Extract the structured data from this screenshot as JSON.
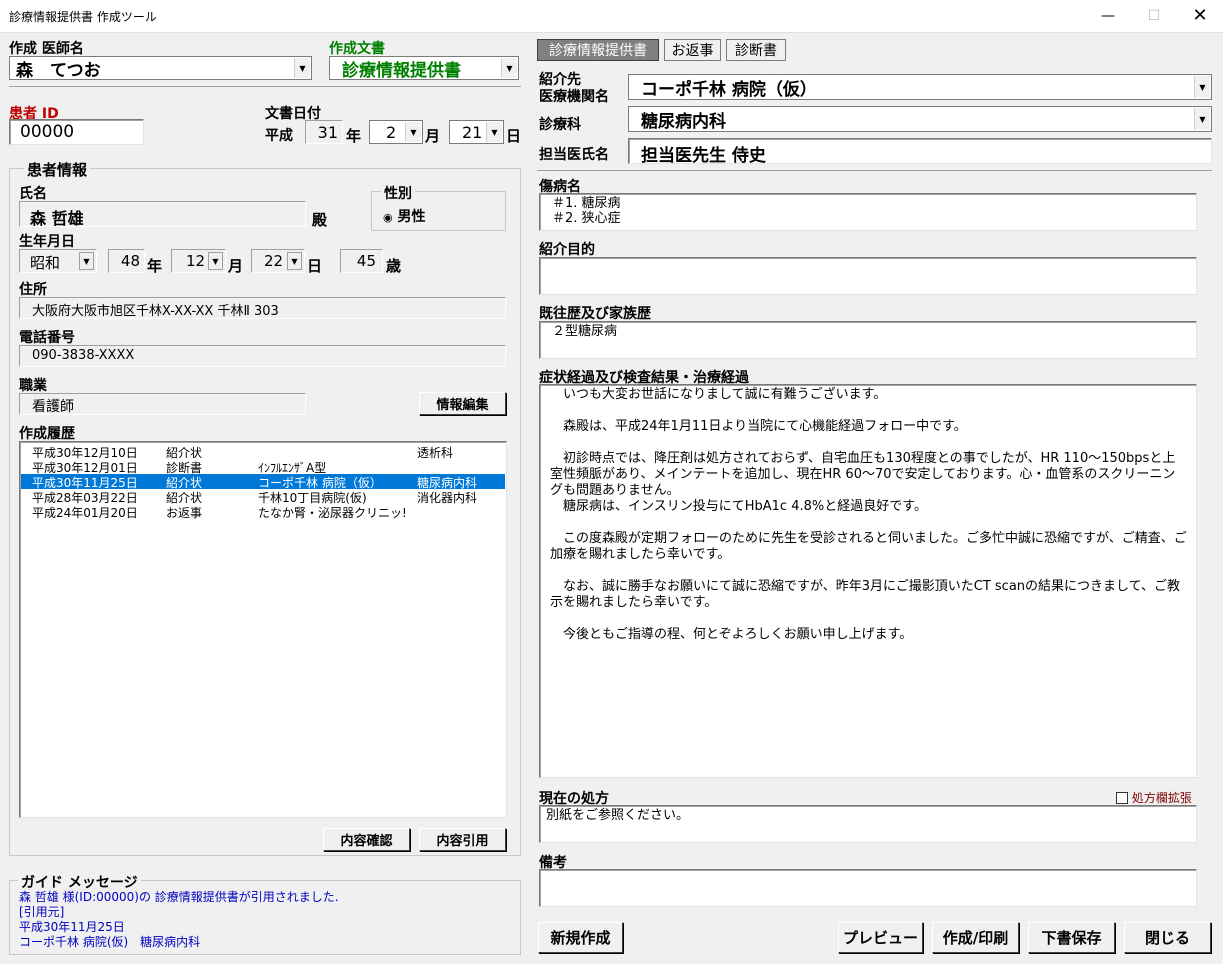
{
  "window": {
    "title": "診療情報提供書 作成ツール"
  },
  "left": {
    "doctor_label": "作成 医師名",
    "doctor_value": "森　てつお",
    "doc_type_label": "作成文書",
    "doc_type_value": "診療情報提供書",
    "patient_id_label": "患者 ID",
    "patient_id_value": "00000",
    "doc_date_label": "文書日付",
    "date_era": "平成",
    "date_year": "31",
    "date_year_unit": "年",
    "date_month": "2",
    "date_month_unit": "月",
    "date_day": "21",
    "date_day_unit": "日"
  },
  "patient": {
    "group_label": "患者情報",
    "name_label": "氏名",
    "name_value": "森 哲雄",
    "honorific": "殿",
    "sex_label": "性別",
    "sex_value": "男性",
    "birth_label": "生年月日",
    "birth_era": "昭和",
    "birth_year": "48",
    "birth_year_unit": "年",
    "birth_month": "12",
    "birth_month_unit": "月",
    "birth_day": "22",
    "birth_day_unit": "日",
    "age": "45",
    "age_unit": "歳",
    "address_label": "住所",
    "address_value": "大阪府大阪市旭区千林X-XX-XX 千林Ⅱ 303",
    "phone_label": "電話番号",
    "phone_value": "090-3838-XXXX",
    "job_label": "職業",
    "job_value": "看護師",
    "edit_button": "情報編集"
  },
  "history": {
    "label": "作成履歴",
    "rows": [
      {
        "date": "平成30年12月10日",
        "type": "紹介状",
        "hospital": "",
        "dept": "透析科"
      },
      {
        "date": "平成30年12月01日",
        "type": "診断書",
        "hospital": "ｲﾝﾌﾙｴﾝｻﾞA型",
        "dept": ""
      },
      {
        "date": "平成30年11月25日",
        "type": "紹介状",
        "hospital": "コーポ千林 病院（仮）",
        "dept": "糖尿病内科"
      },
      {
        "date": "平成28年03月22日",
        "type": "紹介状",
        "hospital": "千林10丁目病院(仮)",
        "dept": "消化器内科"
      },
      {
        "date": "平成24年01月20日",
        "type": "お返事",
        "hospital": "たなか腎・泌尿器クリニッ!",
        "dept": ""
      }
    ],
    "confirm_button": "内容確認",
    "quote_button": "内容引用"
  },
  "guide": {
    "label": "ガイド メッセージ",
    "line1": "森 哲雄 様(ID:00000)の 診療情報提供書が引用されました.",
    "line2": "[引用元]",
    "line3": "平成30年11月25日",
    "line4": "コーポ千林 病院(仮)　糖尿病内科"
  },
  "tabs": [
    "診療情報提供書",
    "お返事",
    "診断書"
  ],
  "right": {
    "ref_label_1": "紹介先",
    "ref_label_2": "医療機関名",
    "ref_value": "コーポ千林 病院（仮）",
    "dept_label": "診療科",
    "dept_value": "糖尿病内科",
    "doctor_label": "担当医氏名",
    "doctor_value": "担当医先生 侍史",
    "disease_label": "傷病名",
    "disease_value": "＃1. 糖尿病\n＃2. 狭心症",
    "purpose_label": "紹介目的",
    "purpose_value": "",
    "past_label": "既往歴及び家族歴",
    "past_value": "２型糖尿病",
    "course_label": "症状経過及び検査結果・治療経過",
    "course_value": "　いつも大変お世話になりまして誠に有難うございます。\n\n　森殿は、平成24年1月11日より当院にて心機能経過フォロー中です。\n\n　初診時点では、降圧剤は処方されておらず、自宅血圧も130程度との事でしたが、HR 110～150bpsと上室性頻脈があり、メインテートを追加し、現在HR 60～70で安定しております。心・血管系のスクリーニングも問題ありません。\n　糖尿病は、インスリン投与にてHbA1c 4.8%と経過良好です。\n\n　この度森殿が定期フォローのために先生を受診されると伺いました。ご多忙中誠に恐縮ですが、ご精査、ご加療を賜れましたら幸いです。\n\n　なお、誠に勝手なお願いにて誠に恐縮ですが、昨年3月にご撮影頂いたCT scanの結果につきまして、ご教示を賜れましたら幸いです。\n\n　今後ともご指導の程、何とぞよろしくお願い申し上げます。",
    "rx_label": "現在の処方",
    "rx_expand": "処方欄拡張",
    "rx_value": "別紙をご参照ください。",
    "notes_label": "備考",
    "notes_value": ""
  },
  "footer": {
    "new_button": "新規作成",
    "preview_button": "プレビュー",
    "print_button": "作成/印刷",
    "draft_button": "下書保存",
    "close_button": "閉じる"
  },
  "colors": {
    "accent_blue": "#0078d7",
    "doc_type_green": "#008000",
    "patient_id_red": "#c00000",
    "guide_text": "#0000c0"
  }
}
